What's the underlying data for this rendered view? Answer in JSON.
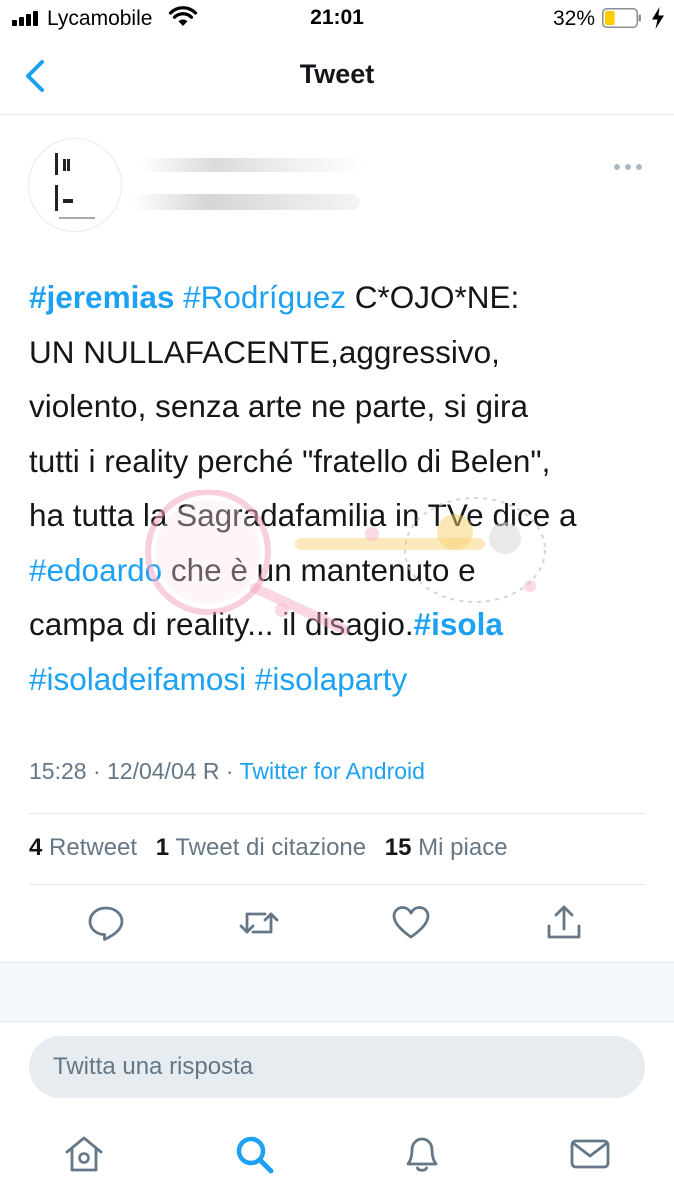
{
  "status_bar": {
    "carrier": "Lycamobile",
    "time": "21:01",
    "battery": "32%",
    "battery_level": 0.32
  },
  "nav": {
    "back_icon": "chevron-left-icon",
    "title": "Tweet"
  },
  "tweet": {
    "lines": [
      [
        {
          "t": "#jeremias",
          "c": "ht b"
        },
        {
          "t": " "
        },
        {
          "t": "#Rodríguez",
          "c": "ht"
        },
        {
          "t": " C*OJO*NE:"
        }
      ],
      [
        {
          "t": "UN NULLAFACENTE,aggressivo,"
        }
      ],
      [
        {
          "t": "violento, senza arte ne parte, si gira"
        }
      ],
      [
        {
          "t": "tutti i reality perché \"fratello di Belen\","
        }
      ],
      [
        {
          "t": "ha tutta la Sagradafamilia in TVe dice a"
        }
      ],
      [
        {
          "t": "#edoardo",
          "c": "ht"
        },
        {
          "t": " che è un mantenuto e"
        }
      ],
      [
        {
          "t": "campa di reality... il disagio."
        },
        {
          "t": "#isola",
          "c": "ht b"
        }
      ],
      [
        {
          "t": "#isoladeifamosi",
          "c": "ht"
        },
        {
          "t": " "
        },
        {
          "t": "#isolaparty",
          "c": "ht"
        }
      ]
    ],
    "time": "15:28 · 12/04/04 R · ",
    "source": "Twitter for Android"
  },
  "stats": {
    "retweets_count": "4",
    "retweets_label": "Retweet",
    "quotes_count": "1",
    "quotes_label": "Tweet di citazione",
    "likes_count": "15",
    "likes_label": "Mi piace"
  },
  "actions": [
    "reply-icon",
    "retweet-icon",
    "like-icon",
    "share-icon"
  ],
  "reply": {
    "placeholder": "Twitta una risposta"
  },
  "tabs": [
    "home-icon",
    "search-icon",
    "notifications-icon",
    "messages-icon"
  ],
  "colors": {
    "accent": "#1da1f2",
    "secondary_text": "#657786",
    "icon_gray": "#657786"
  }
}
